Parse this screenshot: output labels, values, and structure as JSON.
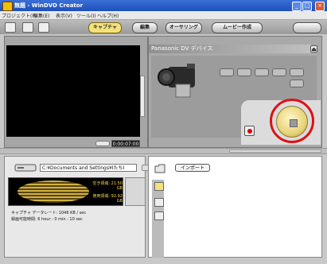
{
  "app": {
    "title": "無題 - WinDVD Creator"
  },
  "menu": [
    "プロジェクト(P)",
    "編集(E)",
    "表示(V)",
    "ツール(I)",
    "ヘルプ(H)"
  ],
  "modes": {
    "capture": "キャプチャ",
    "edit": "編集",
    "authoring": "オーサリング",
    "movie": "ムービー作成"
  },
  "device": {
    "name": "Panasonic DV デバイス"
  },
  "video": {
    "timecode": "0:00:07:00"
  },
  "capture": {
    "path": "C:¥Documents and Settings¥IたちI",
    "free_label": "空き領域: 21.50 GB",
    "used_label": "使用領域: 92.92 GB",
    "rate_line": "キャプチャ データレート: 1046 KB / sec",
    "time_line": "録画可能時間: 6 hour : 0 min : 10 sec"
  },
  "library": {
    "import_label": "インポート"
  },
  "icons": [
    "app-icon",
    "minimize-icon",
    "maximize-icon",
    "close-icon",
    "new-project-icon",
    "open-icon",
    "save-icon",
    "camcorder-icon",
    "record-icon",
    "stop-icon",
    "disk-icon",
    "folder-icon",
    "video-clip-icon",
    "image-icon",
    "audio-icon"
  ]
}
